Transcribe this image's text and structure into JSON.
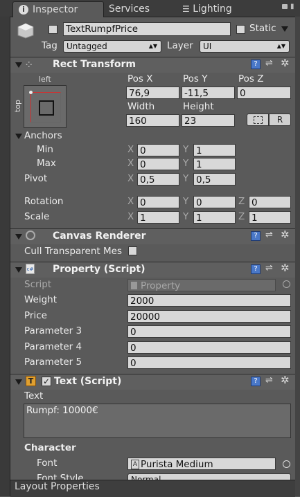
{
  "tabs": [
    {
      "label": "Inspector"
    },
    {
      "label": "Services"
    },
    {
      "label": "Lighting"
    }
  ],
  "object": {
    "name": "TextRumpfPrice",
    "static_label": "Static",
    "tag_label": "Tag",
    "tag_value": "Untagged",
    "layer_label": "Layer",
    "layer_value": "UI"
  },
  "rect_transform": {
    "title": "Rect Transform",
    "anchor_h": "left",
    "anchor_v": "top",
    "pos_x_label": "Pos X",
    "pos_y_label": "Pos Y",
    "pos_z_label": "Pos Z",
    "pos_x": "76,9",
    "pos_y": "-11,5",
    "pos_z": "0",
    "width_label": "Width",
    "height_label": "Height",
    "width": "160",
    "height": "23",
    "r_label": "R",
    "anchors_label": "Anchors",
    "min_label": "Min",
    "max_label": "Max",
    "x_label": "X",
    "y_label": "Y",
    "z_label": "Z",
    "min_x": "0",
    "min_y": "1",
    "max_x": "0",
    "max_y": "1",
    "pivot_label": "Pivot",
    "pivot_x": "0,5",
    "pivot_y": "0,5",
    "rotation_label": "Rotation",
    "rot_x": "0",
    "rot_y": "0",
    "rot_z": "0",
    "scale_label": "Scale",
    "scale_x": "1",
    "scale_y": "1",
    "scale_z": "1"
  },
  "canvas_renderer": {
    "title": "Canvas Renderer",
    "cull_label": "Cull Transparent Mes"
  },
  "property_script": {
    "title": "Property (Script)",
    "script_label": "Script",
    "script_value": "Property",
    "rows": [
      {
        "label": "Weight",
        "value": "2000"
      },
      {
        "label": "Price",
        "value": "20000"
      },
      {
        "label": "Parameter 3",
        "value": "0"
      },
      {
        "label": "Parameter 4",
        "value": "0"
      },
      {
        "label": "Parameter 5",
        "value": "0"
      }
    ]
  },
  "text_script": {
    "title": "Text (Script)",
    "text_label": "Text",
    "text_value": "Rumpf: 10000€",
    "character_label": "Character",
    "font_label": "Font",
    "font_value": "Purista Medium",
    "font_style_label": "Font Style",
    "font_style_value": "Normal"
  },
  "footer": {
    "label": "Layout Properties"
  },
  "colors": {
    "panel": "#5a5a5a",
    "header": "#5f5f5f",
    "field": "#d8d8d8",
    "help_icon": "#4a78c8"
  }
}
